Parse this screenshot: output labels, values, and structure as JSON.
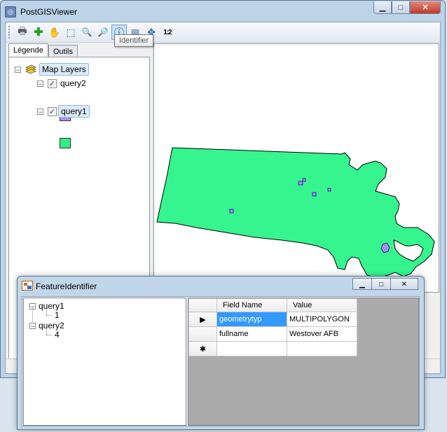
{
  "main_window": {
    "title": "PostGISViewer",
    "controls": {
      "minimize": "▁",
      "maximize": "□",
      "close": "✕"
    }
  },
  "toolbar": {
    "buttons": [
      {
        "name": "print-icon",
        "glyph": "🖶"
      },
      {
        "name": "add-layer-icon",
        "glyph": "✚"
      },
      {
        "name": "pan-hand-icon",
        "glyph": "✋"
      },
      {
        "name": "select-arrow-icon",
        "glyph": "⬚"
      },
      {
        "name": "zoom-in-icon",
        "glyph": "🔍"
      },
      {
        "name": "zoom-out-icon",
        "glyph": "🔎"
      },
      {
        "name": "identify-icon",
        "glyph": "ⓘ"
      },
      {
        "name": "table-icon",
        "glyph": "▦"
      },
      {
        "name": "zoom-extent-icon",
        "glyph": "✥"
      },
      {
        "name": "scale-icon",
        "glyph": "1:2"
      }
    ],
    "tooltip": "Identifier"
  },
  "left_panel": {
    "tabs": [
      "Légende",
      "Outils"
    ],
    "root": "Map Layers",
    "layers": [
      {
        "name": "query2",
        "checked": true,
        "color": "#b08ff0"
      },
      {
        "name": "query1",
        "checked": true,
        "color": "#33ee88"
      }
    ]
  },
  "map": {
    "fill_color": "#36f58e",
    "feature_color": "#a98df0"
  },
  "feature_identifier": {
    "title": "FeatureIdentifier",
    "controls": {
      "minimize": "▁",
      "maximize": "□",
      "close": "✕"
    },
    "tree": [
      {
        "layer": "query1",
        "id": "1"
      },
      {
        "layer": "query2",
        "id": "4"
      }
    ],
    "grid": {
      "columns": [
        "Field Name",
        "Value"
      ],
      "rows": [
        {
          "field": "geometrytyp",
          "value": "MULTIPOLYGON"
        },
        {
          "field": "fullname",
          "value": "Westover AFB"
        }
      ],
      "current_marker": "▶",
      "new_row_marker": "✱"
    }
  }
}
